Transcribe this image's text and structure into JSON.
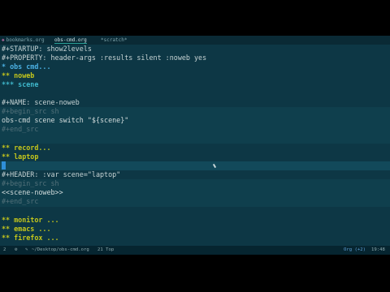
{
  "tabs": [
    {
      "label": "bookmarks.org",
      "active": false,
      "icon": "org-unicorn-icon"
    },
    {
      "label": "obs-cmd.org",
      "active": true,
      "icon": ""
    },
    {
      "label": "*scratch*",
      "active": false,
      "icon": ""
    }
  ],
  "lines": {
    "l1": "#+STARTUP: show2levels",
    "l2": "#+PROPERTY: header-args :results silent :noweb yes",
    "l3": "* obs cmd...",
    "l4": "** noweb",
    "l5": "*** scene",
    "l6": "",
    "l7": "#+NAME: scene-noweb",
    "l8": "#+begin_src sh",
    "l9": "obs-cmd scene switch \"${scene}\"",
    "l10": "#+end_src",
    "l11": "",
    "l12": "** record...",
    "l13": "** laptop",
    "l14": "",
    "l15": "#+HEADER: :var scene=\"laptop\"",
    "l16": "#+begin_src sh",
    "l17": "<<scene-noweb>>",
    "l18": "#+end_src",
    "l19": "",
    "l20": "** monitor ...",
    "l21": "** emacs ...",
    "l22": "** firefox ..."
  },
  "modeline": {
    "window_number": "2",
    "path": "~/Desktop/obs-cmd.org",
    "position": "21 Top",
    "mode": "Org (+2)",
    "time": "19:48"
  }
}
